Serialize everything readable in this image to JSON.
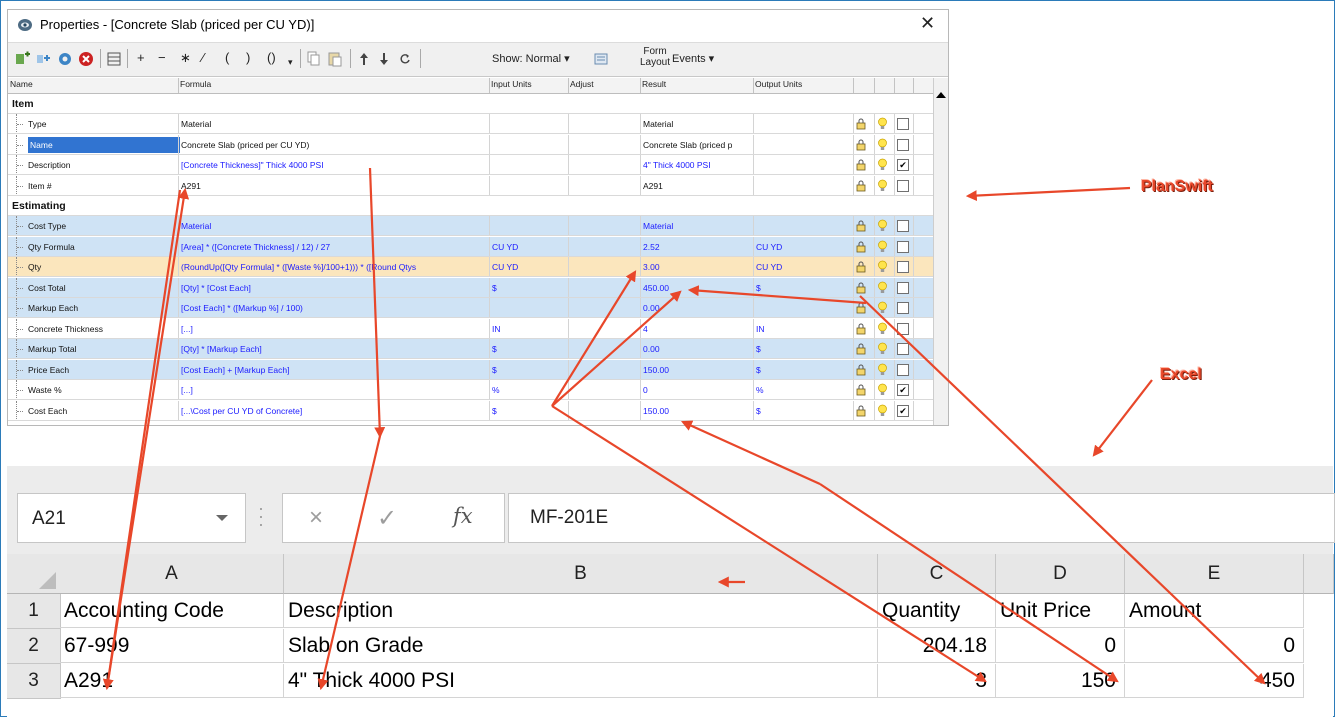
{
  "window": {
    "title": "Properties - [Concrete Slab (priced per CU YD)]",
    "close": "✕"
  },
  "toolbar": {
    "ops": [
      "+",
      "−",
      "∗",
      "∕",
      "(",
      ")",
      "()"
    ],
    "show": "Show: Normal ▾",
    "form": "Form",
    "layout": "Layout",
    "events": "Events ▾"
  },
  "grid": {
    "headers": [
      "Name",
      "Formula",
      "Input Units",
      "Adjust",
      "Result",
      "Output Units"
    ],
    "sections": [
      {
        "label": "Item",
        "rows": [
          {
            "name": "Type",
            "formula": "Material",
            "input": "",
            "adjust": "",
            "result": "Material",
            "output": "",
            "style": "plain",
            "checked": false
          },
          {
            "name": "Name",
            "formula": "Concrete Slab (priced per CU YD)",
            "input": "",
            "adjust": "",
            "result": "Concrete Slab (priced p",
            "output": "",
            "style": "selected",
            "checked": false
          },
          {
            "name": "Description",
            "formula": "[Concrete Thickness]\" Thick 4000 PSI",
            "input": "",
            "adjust": "",
            "result": "4\" Thick 4000 PSI",
            "output": "",
            "style": "formula",
            "checked": true
          },
          {
            "name": "Item #",
            "formula": "A291",
            "input": "",
            "adjust": "",
            "result": "A291",
            "output": "",
            "style": "plain",
            "checked": false
          }
        ]
      },
      {
        "label": "Estimating",
        "rows": [
          {
            "name": "Cost Type",
            "formula": "Material",
            "input": "",
            "adjust": "",
            "result": "Material",
            "output": "",
            "style": "blue",
            "checked": false
          },
          {
            "name": "Qty Formula",
            "formula": "[Area] * ([Concrete Thickness] / 12) / 27",
            "input": "CU YD",
            "adjust": "",
            "result": "2.52",
            "output": "CU YD",
            "style": "blue",
            "checked": false
          },
          {
            "name": "Qty",
            "formula": "(RoundUp([Qty Formula] * ([Waste %]/100+1))) * ([Round Qtys",
            "input": "CU YD",
            "adjust": "",
            "result": "3.00",
            "output": "CU YD",
            "style": "tan",
            "checked": false
          },
          {
            "name": "Cost Total",
            "formula": "[Qty] * [Cost Each]",
            "input": "$",
            "adjust": "",
            "result": "450.00",
            "output": "$",
            "style": "blue",
            "checked": false
          },
          {
            "name": "Markup Each",
            "formula": "[Cost Each] * ([Markup %] / 100)",
            "input": "",
            "adjust": "",
            "result": "0.00",
            "output": "",
            "style": "blue",
            "checked": false
          },
          {
            "name": "Concrete Thickness",
            "formula": "[...]",
            "input": "IN",
            "adjust": "",
            "result": "4",
            "output": "IN",
            "style": "formula",
            "checked": false
          },
          {
            "name": "Markup Total",
            "formula": "[Qty] * [Markup Each]",
            "input": "$",
            "adjust": "",
            "result": "0.00",
            "output": "$",
            "style": "blue",
            "checked": false
          },
          {
            "name": "Price Each",
            "formula": "[Cost Each] + [Markup Each]",
            "input": "$",
            "adjust": "",
            "result": "150.00",
            "output": "$",
            "style": "blue",
            "checked": false
          },
          {
            "name": "Waste %",
            "formula": "[...]",
            "input": "%",
            "adjust": "",
            "result": "0",
            "output": "%",
            "style": "formula",
            "checked": true
          },
          {
            "name": "Cost Each",
            "formula": "[...\\Cost per CU YD of Concrete]",
            "input": "$",
            "adjust": "",
            "result": "150.00",
            "output": "$",
            "style": "formula",
            "checked": true
          }
        ]
      }
    ]
  },
  "callouts": {
    "planswift": "PlanSwift",
    "excel": "Excel"
  },
  "excel": {
    "name_box": "A21",
    "formula_value": "MF-201E",
    "buttons": {
      "cancel": "×",
      "enter": "✓",
      "fx": "fx"
    },
    "columns": [
      "A",
      "B",
      "C",
      "D",
      "E"
    ],
    "rows": [
      {
        "num": "1",
        "cells": [
          "Accounting Code",
          "Description",
          "Quantity",
          "Unit Price",
          "Amount"
        ]
      },
      {
        "num": "2",
        "cells": [
          "67-999",
          "Slab on Grade",
          "204.18",
          "0",
          "0"
        ]
      },
      {
        "num": "3",
        "cells": [
          "A291",
          "4\" Thick 4000 PSI",
          "3",
          "150",
          "450"
        ]
      }
    ]
  },
  "colors": {
    "accent_arrow": "#e8472a",
    "row_blue": "#cfe3f5",
    "row_tan": "#fbe6bd",
    "selected": "#3174d1",
    "formula_text": "#1a1aff"
  }
}
